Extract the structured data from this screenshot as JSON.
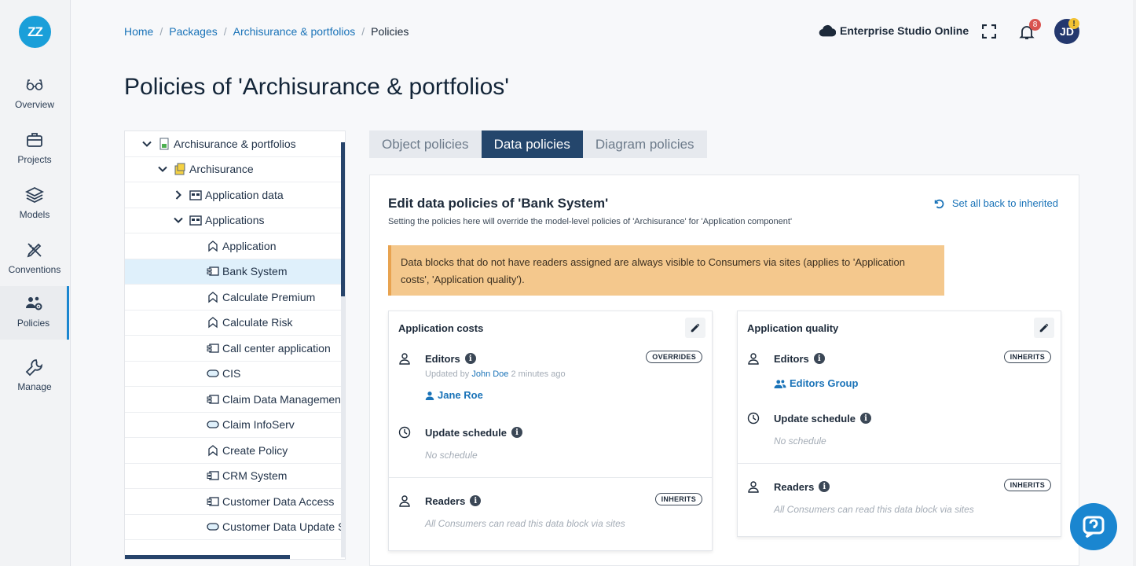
{
  "logo": {
    "text": "ZZ"
  },
  "nav": [
    {
      "label": "Overview",
      "icon": "glasses-icon"
    },
    {
      "label": "Projects",
      "icon": "briefcase-icon"
    },
    {
      "label": "Models",
      "icon": "layers-icon"
    },
    {
      "label": "Conventions",
      "icon": "pen-ruler-icon"
    },
    {
      "label": "Policies",
      "icon": "users-gear-icon",
      "active": true
    },
    {
      "label": "Manage",
      "icon": "wrench-icon"
    }
  ],
  "breadcrumb": [
    "Home",
    "Packages",
    "Archisurance & portfolios",
    "Policies"
  ],
  "header": {
    "studio": "Enterprise Studio Online",
    "notifications": "8",
    "avatar": "JD",
    "avatar_badge": "!"
  },
  "page_title": "Policies of 'Archisurance & portfolios'",
  "tree": [
    {
      "label": "Archisurance & portfolios",
      "level": 0,
      "chevron": "down",
      "icon": "package"
    },
    {
      "label": "Archisurance",
      "level": 1,
      "chevron": "down",
      "icon": "model"
    },
    {
      "label": "Application data",
      "level": 2,
      "chevron": "right",
      "icon": "folder"
    },
    {
      "label": "Applications",
      "level": 2,
      "chevron": "down",
      "icon": "folder"
    },
    {
      "label": "Application",
      "level": 3,
      "icon": "function"
    },
    {
      "label": "Bank System",
      "level": 3,
      "icon": "component",
      "selected": true
    },
    {
      "label": "Calculate Premium",
      "level": 3,
      "icon": "function"
    },
    {
      "label": "Calculate Risk",
      "level": 3,
      "icon": "function"
    },
    {
      "label": "Call center application",
      "level": 3,
      "icon": "component"
    },
    {
      "label": "CIS",
      "level": 3,
      "icon": "service"
    },
    {
      "label": "Claim Data Management",
      "level": 3,
      "icon": "component"
    },
    {
      "label": "Claim InfoServ",
      "level": 3,
      "icon": "service"
    },
    {
      "label": "Create Policy",
      "level": 3,
      "icon": "function"
    },
    {
      "label": "CRM System",
      "level": 3,
      "icon": "component"
    },
    {
      "label": "Customer Data Access",
      "level": 3,
      "icon": "component"
    },
    {
      "label": "Customer Data Update Ser",
      "level": 3,
      "icon": "service"
    }
  ],
  "tabs": [
    {
      "label": "Object policies"
    },
    {
      "label": "Data policies",
      "active": true
    },
    {
      "label": "Diagram policies"
    }
  ],
  "panel": {
    "title": "Edit data policies of 'Bank System'",
    "subtitle": "Setting the policies here will override the model-level policies of 'Archisurance' for 'Application component'",
    "reset_label": "Set all back to inherited",
    "warning": "Data blocks that do not have readers assigned are always visible to Consumers via sites (applies to 'Application costs', 'Application quality')."
  },
  "cards": {
    "costs": {
      "title": "Application costs",
      "editors_label": "Editors",
      "editors_badge": "OVERRIDES",
      "updated_prefix": "Updated by",
      "updated_by": "John Doe",
      "updated_when": "2 minutes ago",
      "editor_person": "Jane Roe",
      "schedule_label": "Update schedule",
      "schedule_value": "No schedule",
      "readers_label": "Readers",
      "readers_badge": "INHERITS",
      "readers_value": "All Consumers can read this data block via sites"
    },
    "quality": {
      "title": "Application quality",
      "editors_label": "Editors",
      "editors_badge": "INHERITS",
      "editor_group": "Editors Group",
      "schedule_label": "Update schedule",
      "schedule_value": "No schedule",
      "readers_label": "Readers",
      "readers_badge": "INHERITS",
      "readers_value": "All Consumers can read this data block via sites"
    }
  },
  "info_glyph": "i"
}
